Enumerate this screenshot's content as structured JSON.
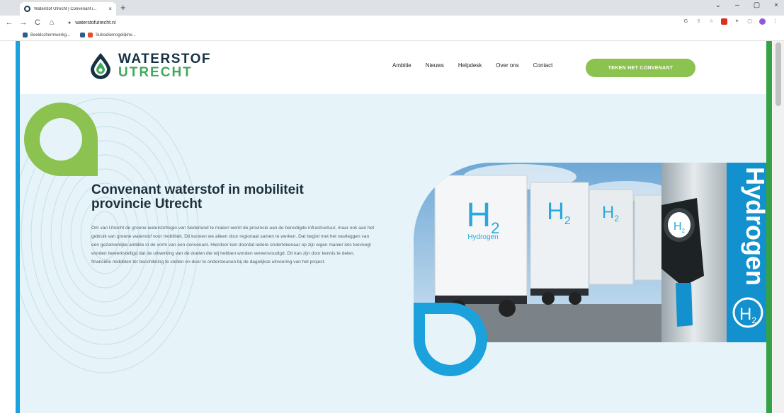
{
  "browser": {
    "tab_title": "Waterstof Utrecht | Convenant i...",
    "tab_close": "×",
    "new_tab": "+",
    "window_controls": [
      "⌄",
      "–",
      "▢",
      "×"
    ],
    "nav": {
      "back": "←",
      "forward": "→",
      "reload": "C",
      "home": "⌂"
    },
    "url": "waterstofutrecht.nl",
    "lock": "●",
    "bookmarks": [
      "Beeldschermwerkg...",
      "Subsidiemogelijkhe..."
    ]
  },
  "site": {
    "logo_top": "WATERSTOF",
    "logo_bottom": "UTRECHT",
    "nav": [
      "Ambitie",
      "Nieuws",
      "Helpdesk",
      "Over ons",
      "Contact"
    ],
    "cta": "TEKEN HET CONVENANT"
  },
  "hero": {
    "title": "Convenant waterstof in mobiliteit provincie Utrecht",
    "body": "Om van Utrecht de groene waterstofregio van Nederland te maken werkt de provincie aan de benodigde infrastructuur, maar ook aan het gebruik van groene waterstof voor mobiliteit. Dit kunnen we alleen door regionaal samen te werken. Dat begint met het vastleggen van een gezamenlijke ambitie in de vorm van een convenant. Hierdoor kan doordat iedere ondertekenaar op zijn eigen manier iets toevoegt worden bewerkstelligd dat de uitwerking van de doelen die wij hebben worden vereenvoudigd. Dit kan zijn door kennis te delen, financiële middelen ter beschikking te stellen en door te ondersteunen bij de dagelijkse uitvoering van het project."
  },
  "photo": {
    "pillar_text": "Hydrogen",
    "truck_brand": "Hydrogen",
    "h2": "H",
    "h2_sub": "2",
    "h2_big": "H2"
  },
  "colors": {
    "brand_navy": "#163144",
    "brand_green": "#43a85c",
    "cta_green": "#8cc24f",
    "accent_blue": "#1ba1dc",
    "hero_bg": "#e6f4fa"
  }
}
